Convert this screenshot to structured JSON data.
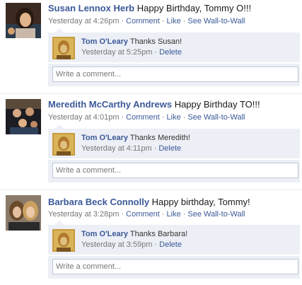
{
  "stories": [
    {
      "author": "Susan Lennox Herb",
      "message": "Happy Birthday, Tommy O!!!",
      "time": "Yesterday at 4:26pm",
      "actions": [
        "Comment",
        "Like",
        "See Wall-to-Wall"
      ],
      "comment": {
        "author": "Tom O'Leary",
        "text": "Thanks Susan!",
        "time": "Yesterday at 5:25pm",
        "action": "Delete"
      },
      "write_placeholder": "Write a comment..."
    },
    {
      "author": "Meredith McCarthy Andrews",
      "message": "Happy Birthday TO!!!",
      "time": "Yesterday at 4:01pm",
      "actions": [
        "Comment",
        "Like",
        "See Wall-to-Wall"
      ],
      "comment": {
        "author": "Tom O'Leary",
        "text": "Thanks Meredith!",
        "time": "Yesterday at 4:11pm",
        "action": "Delete"
      },
      "write_placeholder": "Write a comment..."
    },
    {
      "author": "Barbara Beck Connolly",
      "message": "Happy birthday, Tommy!",
      "time": "Yesterday at 3:28pm",
      "actions": [
        "Comment",
        "Like",
        "See Wall-to-Wall"
      ],
      "comment": {
        "author": "Tom O'Leary",
        "text": "Thanks Barbara!",
        "time": "Yesterday at 3:59pm",
        "action": "Delete"
      },
      "write_placeholder": "Write a comment..."
    }
  ],
  "separator": "·",
  "colors": {
    "link": "#3b5998",
    "meta": "#777777",
    "comment_bg": "#eceff5",
    "input_border": "#bdc7d8"
  },
  "icons": {
    "avatar": "profile-photo",
    "comment_avatar": "profile-photo"
  }
}
